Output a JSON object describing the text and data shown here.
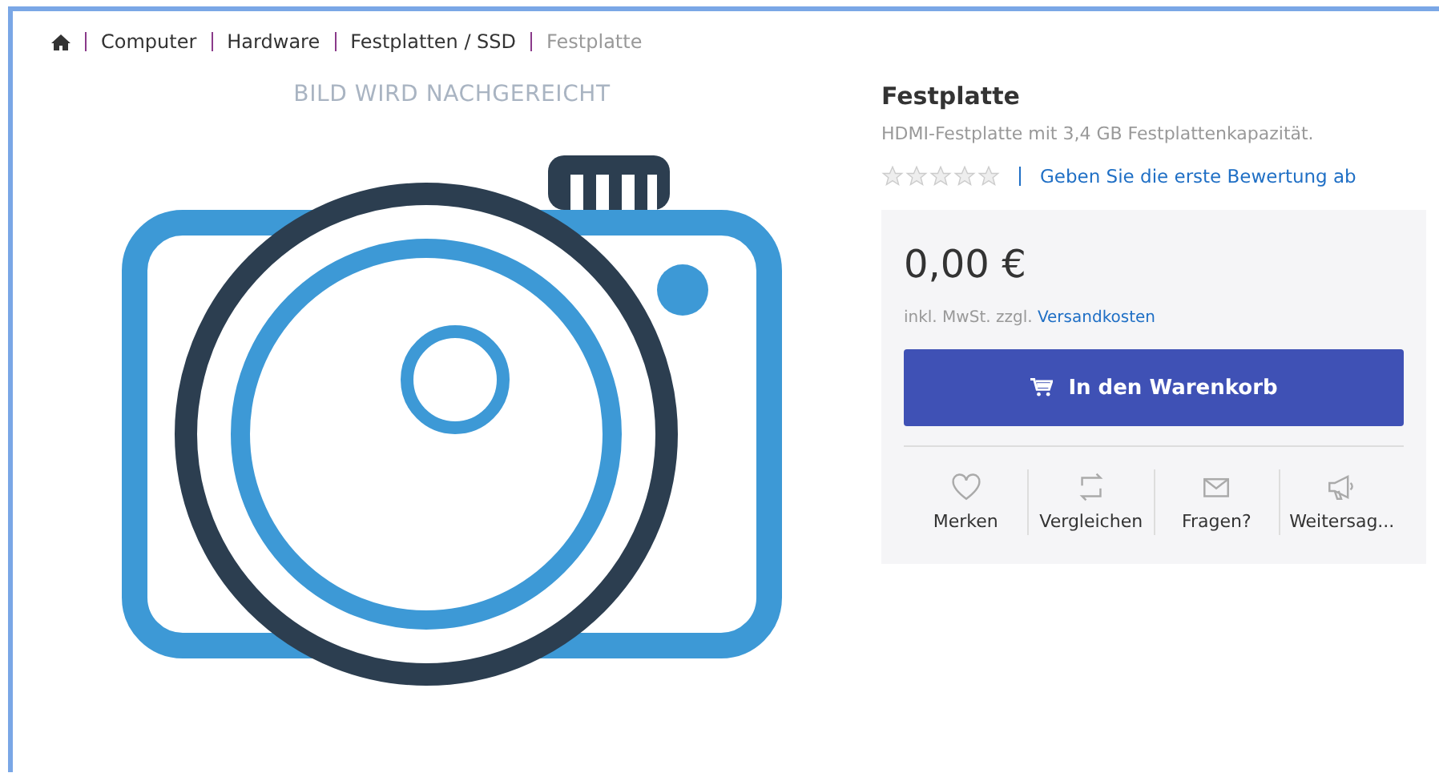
{
  "breadcrumb": [
    {
      "kind": "home"
    },
    {
      "label": "Computer",
      "current": false
    },
    {
      "label": "Hardware",
      "current": false
    },
    {
      "label": "Festplatten / SSD",
      "current": false
    },
    {
      "label": "Festplatte",
      "current": true
    }
  ],
  "image": {
    "caption": "BILD WIRD NACHGEREICHT"
  },
  "product": {
    "title": "Festplatte",
    "description": "HDMI-Festplatte mit 3,4 GB Festplattenkapazität.",
    "stars": 0,
    "review_link": "Geben Sie die erste Bewertung ab"
  },
  "buybox": {
    "price": "0,00 €",
    "tax_note": "inkl. MwSt. zzgl.",
    "shipping_link": "Versandkosten",
    "cart_button": "In den Warenkorb",
    "actions": [
      {
        "kind": "heart",
        "label": "Merken"
      },
      {
        "kind": "compare",
        "label": "Vergleichen"
      },
      {
        "kind": "mail",
        "label": "Fragen?"
      },
      {
        "kind": "megaphone",
        "label": "Weitersag..."
      }
    ]
  }
}
